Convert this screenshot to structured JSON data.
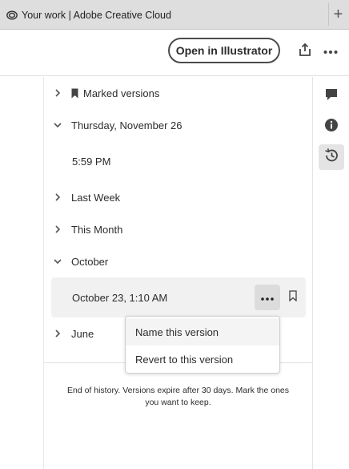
{
  "browser": {
    "tab_title": "Your work | Adobe Creative Cloud",
    "tab_icon": "creative-cloud-icon",
    "new_tab_label": "+"
  },
  "header": {
    "open_button": "Open in Illustrator",
    "share_icon": "share-icon",
    "more_icon": "more-icon"
  },
  "versions": {
    "groups": [
      {
        "label": "Marked versions",
        "expanded": false,
        "bookmark": true
      },
      {
        "label": "Thursday, November 26",
        "expanded": true,
        "items": [
          "5:59 PM"
        ]
      },
      {
        "label": "Last Week",
        "expanded": false
      },
      {
        "label": "This Month",
        "expanded": false
      },
      {
        "label": "October",
        "expanded": true,
        "items": [
          "October 23, 1:10 AM"
        ]
      },
      {
        "label": "June",
        "expanded": false
      }
    ],
    "end_message": "End of history. Versions expire after 30 days. Mark the ones you want to keep."
  },
  "context_menu": {
    "items": [
      "Name this version",
      "Revert to this version"
    ]
  },
  "rail": {
    "icons": [
      "comment-icon",
      "info-icon",
      "history-icon"
    ],
    "active": "history-icon"
  },
  "colors": {
    "accent_text": "#2c2c2c",
    "tabbar_bg": "#dedede",
    "selected_row_bg": "#f1f1f1"
  }
}
